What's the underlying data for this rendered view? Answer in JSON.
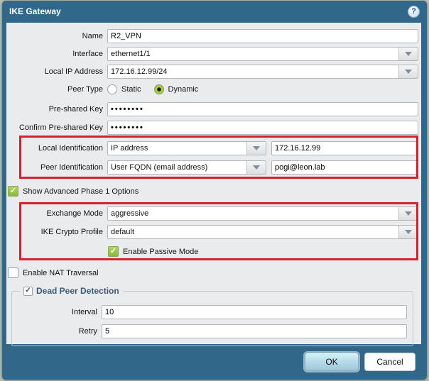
{
  "dialog": {
    "title": "IKE Gateway",
    "help_glyph": "?"
  },
  "fields": {
    "name": {
      "label": "Name",
      "value": "R2_VPN"
    },
    "interface": {
      "label": "Interface",
      "value": "ethernet1/1"
    },
    "local_ip": {
      "label": "Local IP Address",
      "value": "172.16.12.99/24"
    },
    "peer_type": {
      "label": "Peer Type",
      "options": [
        "Static",
        "Dynamic"
      ],
      "selected": "Dynamic"
    },
    "psk": {
      "label": "Pre-shared Key",
      "value": "••••••••"
    },
    "confirm_psk": {
      "label": "Confirm Pre-shared Key",
      "value": "••••••••"
    },
    "local_id": {
      "label": "Local Identification",
      "type_value": "IP address",
      "id_value": "172.16.12.99"
    },
    "peer_id": {
      "label": "Peer Identification",
      "type_value": "User FQDN (email address)",
      "id_value": "pogi@leon.lab"
    },
    "show_advanced": {
      "label": "Show Advanced Phase 1 Options",
      "checked": true
    },
    "exchange_mode": {
      "label": "Exchange Mode",
      "value": "aggressive"
    },
    "ike_crypto": {
      "label": "IKE Crypto Profile",
      "value": "default"
    },
    "passive_mode": {
      "label": "Enable Passive Mode",
      "checked": true
    },
    "nat_traversal": {
      "label": "Enable NAT Traversal",
      "checked": false
    },
    "dpd": {
      "label": "Dead Peer Detection",
      "checked": true,
      "interval": {
        "label": "Interval",
        "value": "10"
      },
      "retry": {
        "label": "Retry",
        "value": "5"
      }
    }
  },
  "footer": {
    "ok": "OK",
    "cancel": "Cancel"
  },
  "icons": {
    "check": "✓",
    "dropdown": "chevron-down"
  },
  "colors": {
    "titlebar": "#31688a",
    "content_bg": "#eaebed",
    "red_highlight": "#d3222a",
    "check_green": "#85bb33"
  }
}
